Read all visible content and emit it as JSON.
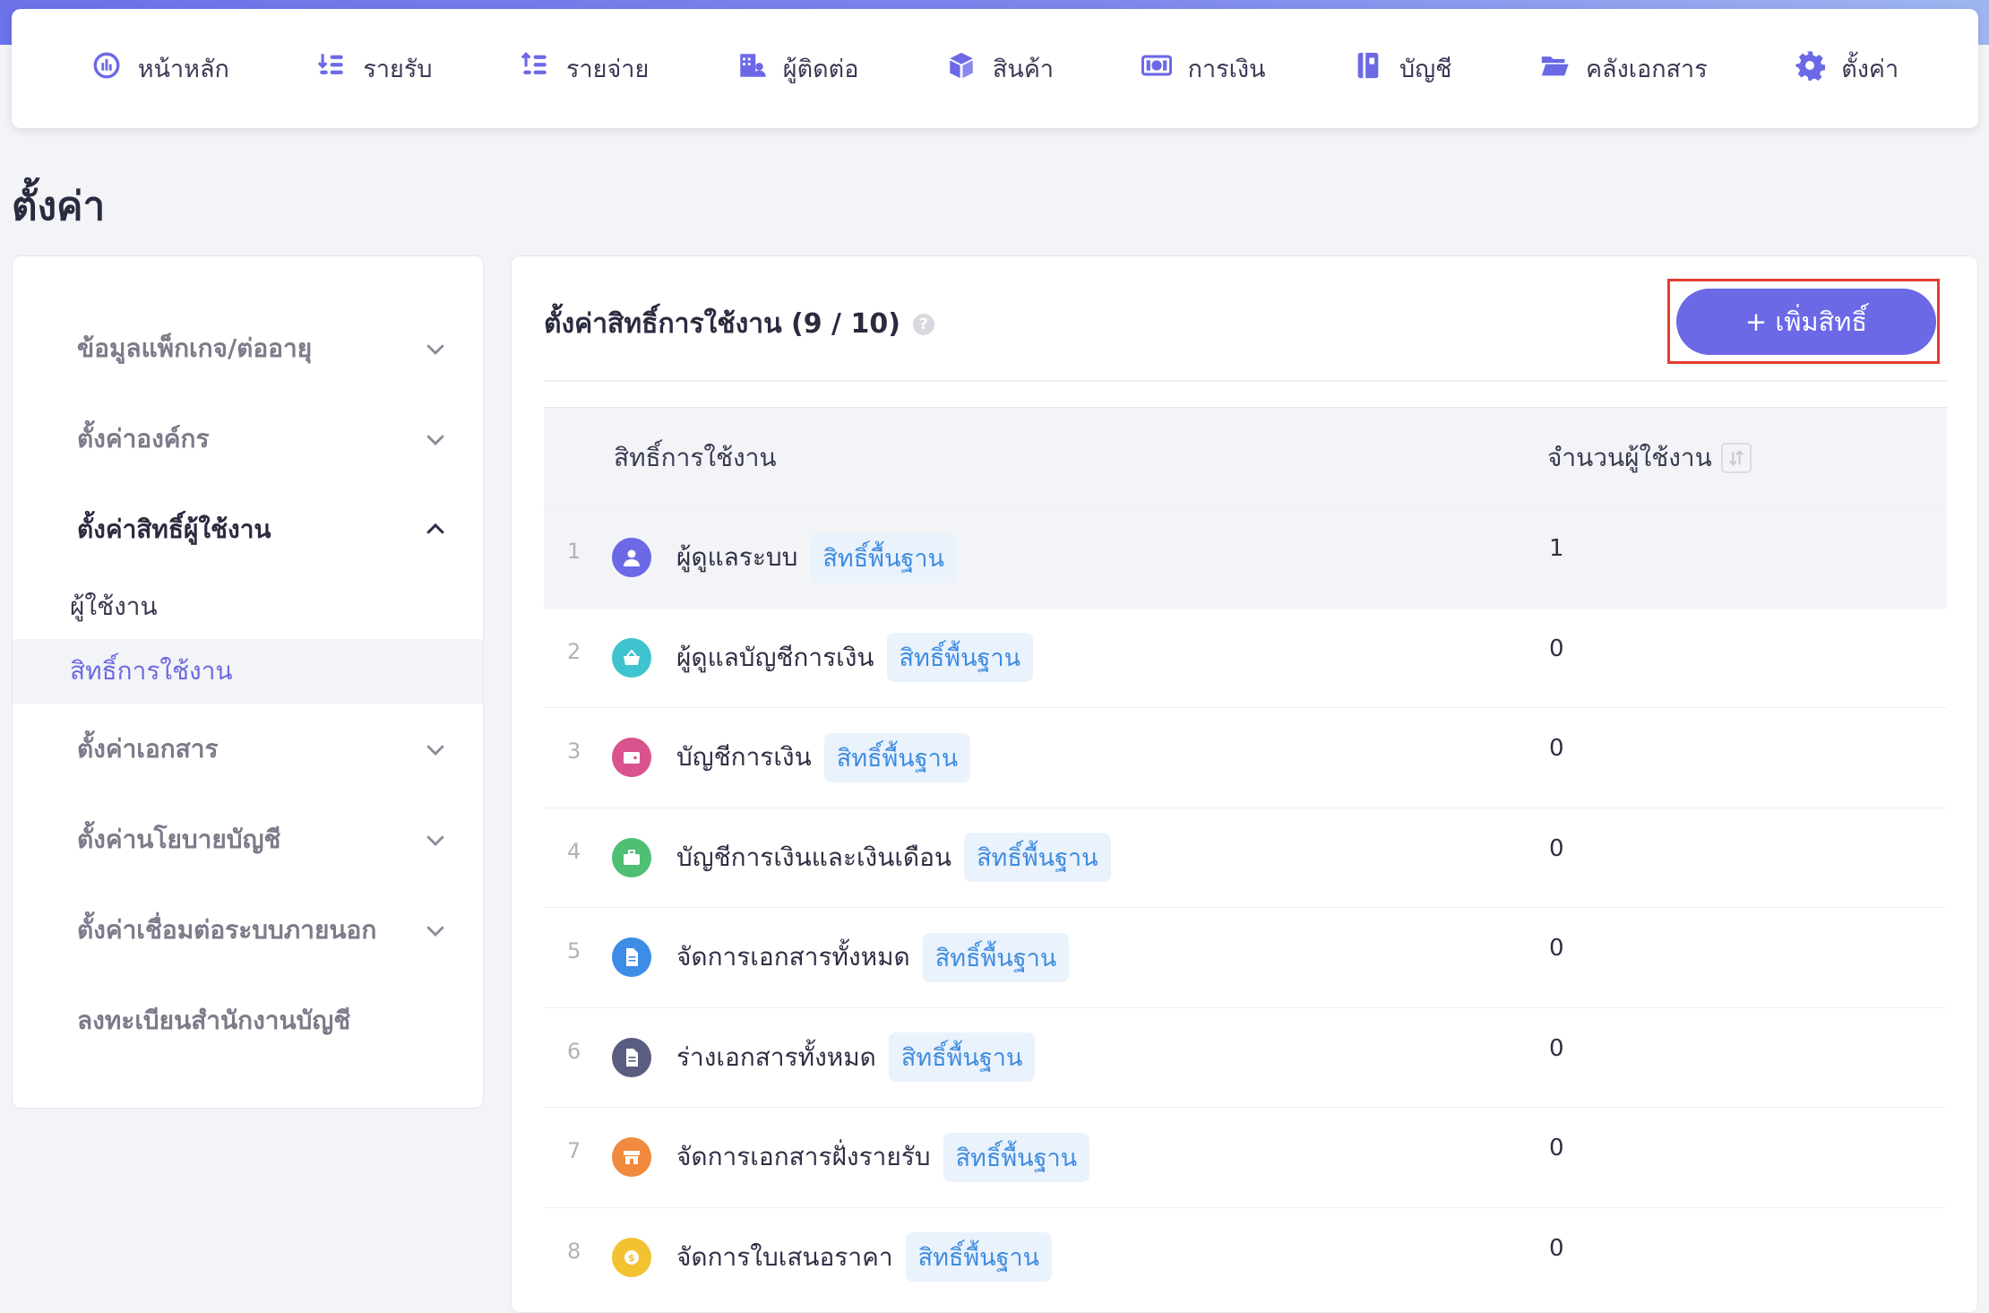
{
  "nav": {
    "items": [
      {
        "label": "หน้าหลัก",
        "icon": "dashboard-icon"
      },
      {
        "label": "รายรับ",
        "icon": "income-icon"
      },
      {
        "label": "รายจ่าย",
        "icon": "expense-icon"
      },
      {
        "label": "ผู้ติดต่อ",
        "icon": "contacts-icon"
      },
      {
        "label": "สินค้า",
        "icon": "product-box-icon"
      },
      {
        "label": "การเงิน",
        "icon": "money-icon"
      },
      {
        "label": "บัญชี",
        "icon": "ledger-icon"
      },
      {
        "label": "คลังเอกสาร",
        "icon": "folder-icon"
      },
      {
        "label": "ตั้งค่า",
        "icon": "gear-icon"
      }
    ]
  },
  "page": {
    "title": "ตั้งค่า"
  },
  "sidebar": {
    "sections": [
      {
        "label": "ข้อมูลแพ็กเกจ/ต่ออายุ"
      },
      {
        "label": "ตั้งค่าองค์กร"
      },
      {
        "label": "ตั้งค่าสิทธิ์ผู้ใช้งาน"
      },
      {
        "label": "ตั้งค่าเอกสาร"
      },
      {
        "label": "ตั้งค่านโยบายบัญชี"
      },
      {
        "label": "ตั้งค่าเชื่อมต่อระบบภายนอก"
      },
      {
        "label": "ลงทะเบียนสำนักงานบัญชี"
      }
    ],
    "subitems": [
      {
        "label": "ผู้ใช้งาน"
      },
      {
        "label": "สิทธิ์การใช้งาน"
      }
    ]
  },
  "card": {
    "title": "ตั้งค่าสิทธิ์การใช้งาน (9 / 10)",
    "help": "?",
    "add_button": "+ เพิ่มสิทธิ์"
  },
  "table": {
    "headers": {
      "name": "สิทธิ์การใช้งาน",
      "count": "จำนวนผู้ใช้งาน"
    },
    "badge_label": "สิทธิ์พื้นฐาน",
    "rows": [
      {
        "num": "1",
        "name": "ผู้ดูแลระบบ",
        "count": "1",
        "icon": "admin-user-icon",
        "color": "#6b69e6"
      },
      {
        "num": "2",
        "name": "ผู้ดูแลบัญชีการเงิน",
        "count": "0",
        "icon": "basket-icon",
        "color": "#3ec3cf"
      },
      {
        "num": "3",
        "name": "บัญชีการเงิน",
        "count": "0",
        "icon": "wallet-icon",
        "color": "#d9538e"
      },
      {
        "num": "4",
        "name": "บัญชีการเงินและเงินเดือน",
        "count": "0",
        "icon": "briefcase-icon",
        "color": "#4fbf74"
      },
      {
        "num": "5",
        "name": "จัดการเอกสารทั้งหมด",
        "count": "0",
        "icon": "document-icon",
        "color": "#3d8de6"
      },
      {
        "num": "6",
        "name": "ร่างเอกสารทั้งหมด",
        "count": "0",
        "icon": "draft-document-icon",
        "color": "#5a5d80"
      },
      {
        "num": "7",
        "name": "จัดการเอกสารฝั่งรายรับ",
        "count": "0",
        "icon": "store-icon",
        "color": "#ef8a3e"
      },
      {
        "num": "8",
        "name": "จัดการใบเสนอราคา",
        "count": "0",
        "icon": "coin-icon",
        "color": "#f2c230"
      }
    ]
  }
}
